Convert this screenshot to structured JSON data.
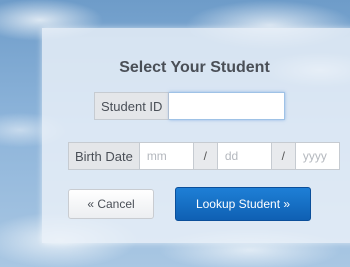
{
  "form": {
    "title": "Select Your Student",
    "student_id": {
      "label": "Student ID",
      "value": "",
      "placeholder": ""
    },
    "birth_date": {
      "label": "Birth Date",
      "month_placeholder": "mm",
      "day_placeholder": "dd",
      "year_placeholder": "yyyy",
      "separator": "/"
    },
    "buttons": {
      "cancel_label": "« Cancel",
      "lookup_label": "Lookup Student »"
    }
  },
  "colors": {
    "primary_button": "#1470c6",
    "panel": "#ecf2f9",
    "sky": "#8db4da"
  }
}
